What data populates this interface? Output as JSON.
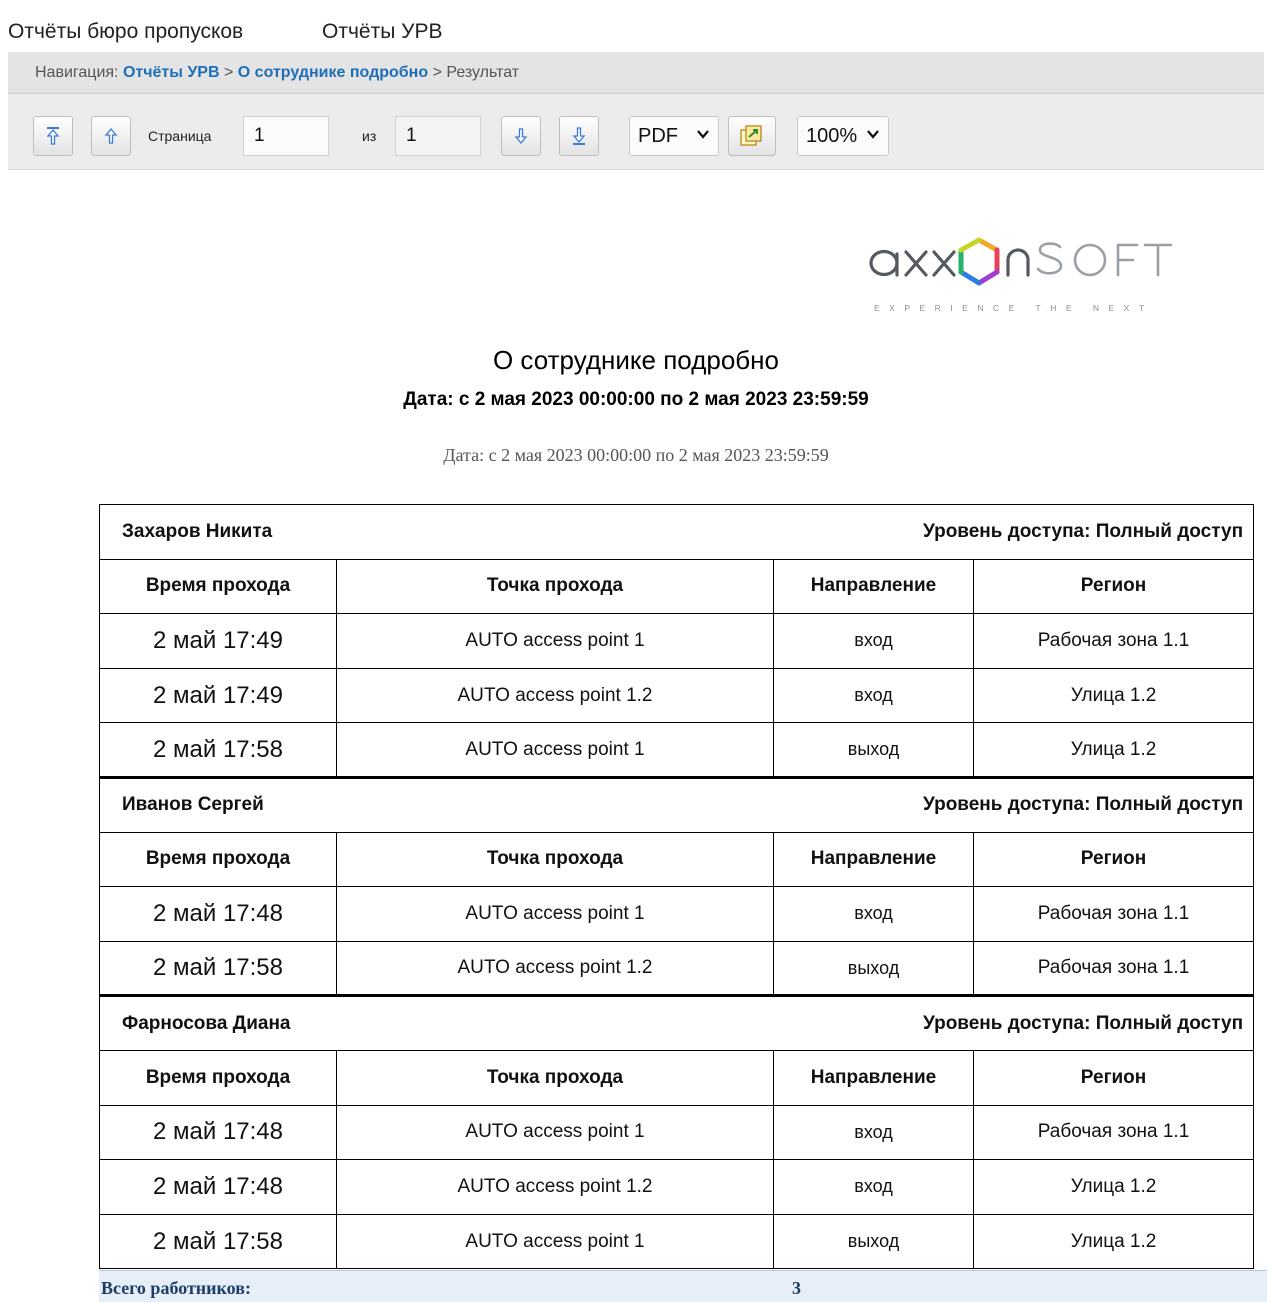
{
  "top_menu": [
    "Отчёты бюро пропусков",
    "Отчёты УРВ"
  ],
  "nav": {
    "prefix": "Навигация:",
    "crumb1": "Отчёты УРВ",
    "sep": ">",
    "crumb2": "О сотруднике подробно",
    "current": "Результат"
  },
  "toolbar": {
    "page_label": "Страница",
    "page_value": "1",
    "of_label": "из",
    "total_pages": "1",
    "format": "PDF",
    "zoom": "100%"
  },
  "logo": {
    "brand": "axxonsoft",
    "tagline": "EXPERIENCE THE NEXT"
  },
  "report": {
    "title": "О сотруднике подробно",
    "date_bold": "Дата: с 2 мая 2023 00:00:00 по 2 мая 2023 23:59:59",
    "date_plain": "Дата: с 2 мая 2023 00:00:00 по 2 мая 2023 23:59:59",
    "headers": [
      "Время прохода",
      "Точка прохода",
      "Направление",
      "Регион"
    ],
    "employees": [
      {
        "name": "Захаров Никита",
        "level": "Уровень доступа: Полный доступ",
        "rows": [
          [
            "2 май 17:49",
            "AUTO access point 1",
            "вход",
            "Рабочая зона 1.1"
          ],
          [
            "2 май 17:49",
            "AUTO access point 1.2",
            "вход",
            "Улица 1.2"
          ],
          [
            "2 май 17:58",
            "AUTO access point 1",
            "выход",
            "Улица 1.2"
          ]
        ]
      },
      {
        "name": "Иванов Сергей",
        "level": "Уровень доступа: Полный доступ",
        "rows": [
          [
            "2 май 17:48",
            "AUTO access point 1",
            "вход",
            "Рабочая зона 1.1"
          ],
          [
            "2 май 17:58",
            "AUTO access point 1.2",
            "выход",
            "Рабочая зона 1.1"
          ]
        ]
      },
      {
        "name": "Фарносова Диана",
        "level": "Уровень доступа: Полный доступ",
        "rows": [
          [
            "2 май 17:48",
            "AUTO access point 1",
            "вход",
            "Рабочая зона 1.1"
          ],
          [
            "2 май 17:48",
            "AUTO access point 1.2",
            "вход",
            "Улица 1.2"
          ],
          [
            "2 май 17:58",
            "AUTO access point 1",
            "выход",
            "Улица 1.2"
          ]
        ]
      }
    ],
    "total_label": "Всего работников:",
    "total_value": "3"
  },
  "colors": {
    "link": "#1f6fb8",
    "nav_bg": "#e4e4e4",
    "toolbar_bg": "#ececec",
    "totals_bg": "#e6eff8",
    "totals_text": "#1c3d66"
  },
  "icons": {
    "first_page": "first-page-icon",
    "prev_page": "prev-page-icon",
    "next_page": "next-page-icon",
    "last_page": "last-page-icon",
    "export": "export-icon",
    "dropdown": "chevron-down-icon"
  }
}
